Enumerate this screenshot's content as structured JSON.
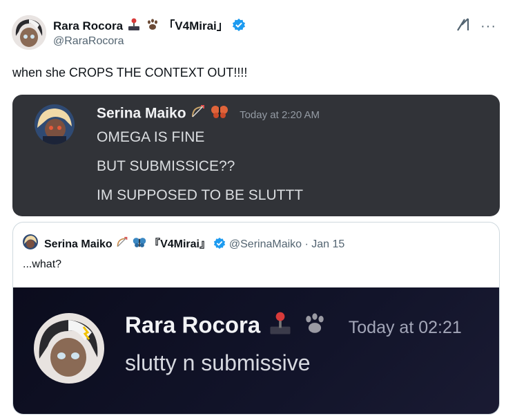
{
  "post": {
    "author_name": "Rara Rocora",
    "author_tag": "「V4Mirai」",
    "author_handle": "@RaraRocora",
    "text": "when she CROPS THE CONTEXT OUT!!!!"
  },
  "top_icons": {
    "grok": "grok-icon",
    "more": "···"
  },
  "image1": {
    "username": "Serina Maiko",
    "timestamp": "Today at 2:20 AM",
    "messages": [
      "OMEGA IS FINE",
      "BUT SUBMISSICE??",
      "IM SUPPOSED TO BE SLUTTT"
    ]
  },
  "quote": {
    "author_name": "Serina Maiko",
    "author_tag": "『V4Mirai』",
    "handle_date": "@SerinaMaiko · Jan 15",
    "text": "...what?"
  },
  "image2": {
    "username": "Rara Rocora",
    "timestamp": "Today at 02:21",
    "message": "slutty n submissive"
  },
  "colors": {
    "verified": "#1d9bf0",
    "discord_bg": "#313338",
    "handle": "#536471"
  }
}
